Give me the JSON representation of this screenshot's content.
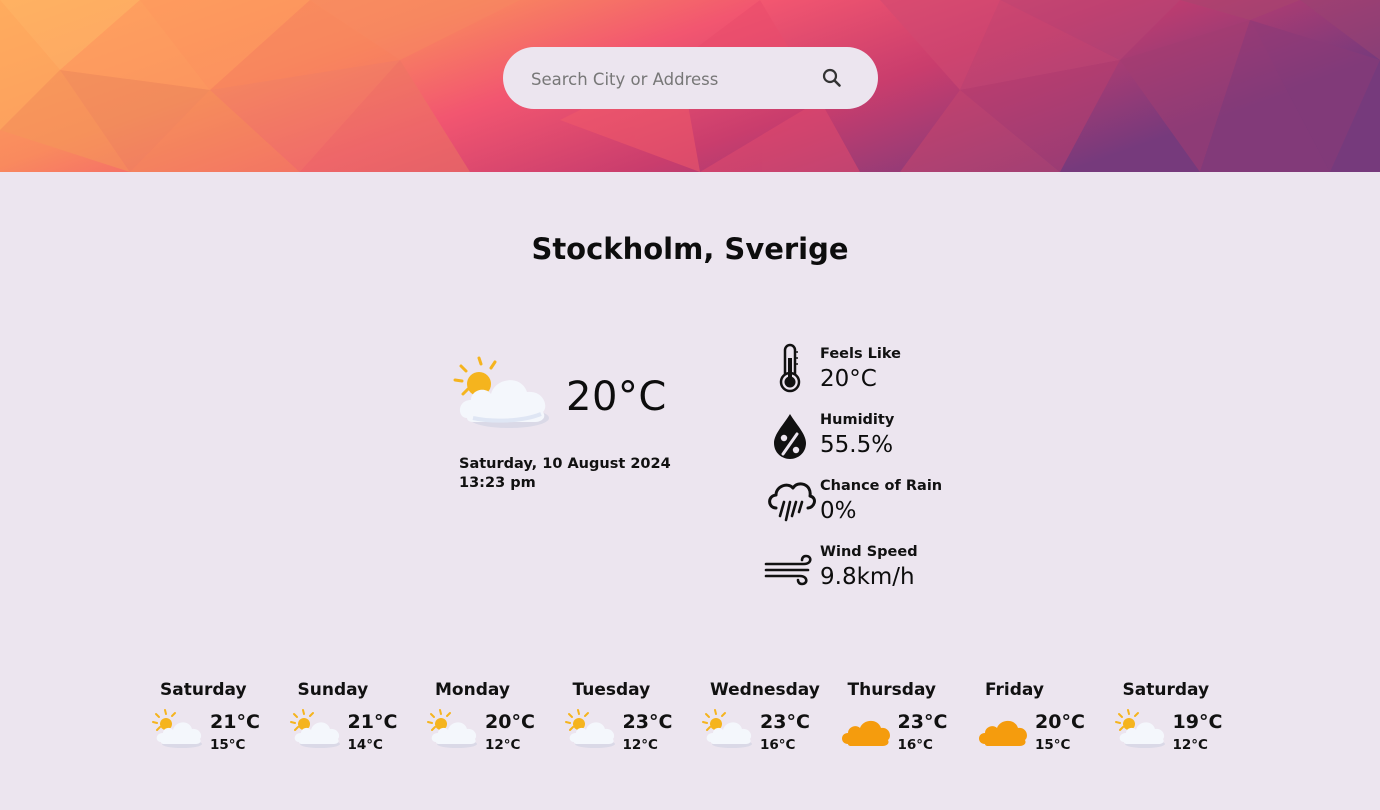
{
  "search": {
    "placeholder": "Search City or Address",
    "value": "",
    "icon": "search-icon"
  },
  "location": "Stockholm, Sverige",
  "current": {
    "icon": "partly-cloudy-icon",
    "temperature": "20°C",
    "date": "Saturday, 10 August 2024",
    "time": "13:23 pm"
  },
  "details": [
    {
      "icon": "thermometer-icon",
      "label": "Feels Like",
      "value": "20°C"
    },
    {
      "icon": "humidity-icon",
      "label": "Humidity",
      "value": "55.5%"
    },
    {
      "icon": "rain-cloud-icon",
      "label": "Chance of Rain",
      "value": "0%"
    },
    {
      "icon": "wind-icon",
      "label": "Wind Speed",
      "value": "9.8km/h"
    }
  ],
  "forecast": [
    {
      "day": "Saturday",
      "icon": "partly-cloudy-icon",
      "high": "21°C",
      "low": "15°C"
    },
    {
      "day": "Sunday",
      "icon": "partly-cloudy-icon",
      "high": "21°C",
      "low": "14°C"
    },
    {
      "day": "Monday",
      "icon": "partly-cloudy-icon",
      "high": "20°C",
      "low": "12°C"
    },
    {
      "day": "Tuesday",
      "icon": "partly-cloudy-icon",
      "high": "23°C",
      "low": "12°C"
    },
    {
      "day": "Wednesday",
      "icon": "partly-cloudy-icon",
      "high": "23°C",
      "low": "16°C"
    },
    {
      "day": "Thursday",
      "icon": "cloud-icon",
      "high": "23°C",
      "low": "16°C"
    },
    {
      "day": "Friday",
      "icon": "cloud-icon",
      "high": "20°C",
      "low": "15°C"
    },
    {
      "day": "Saturday",
      "icon": "partly-cloudy-icon",
      "high": "19°C",
      "low": "12°C"
    }
  ],
  "colors": {
    "background": "#ece5ef",
    "sun": "#f5b41e",
    "cloud_orange": "#f59c0d",
    "banner_left": "#ffab5e",
    "banner_right": "#7a3a7f"
  }
}
